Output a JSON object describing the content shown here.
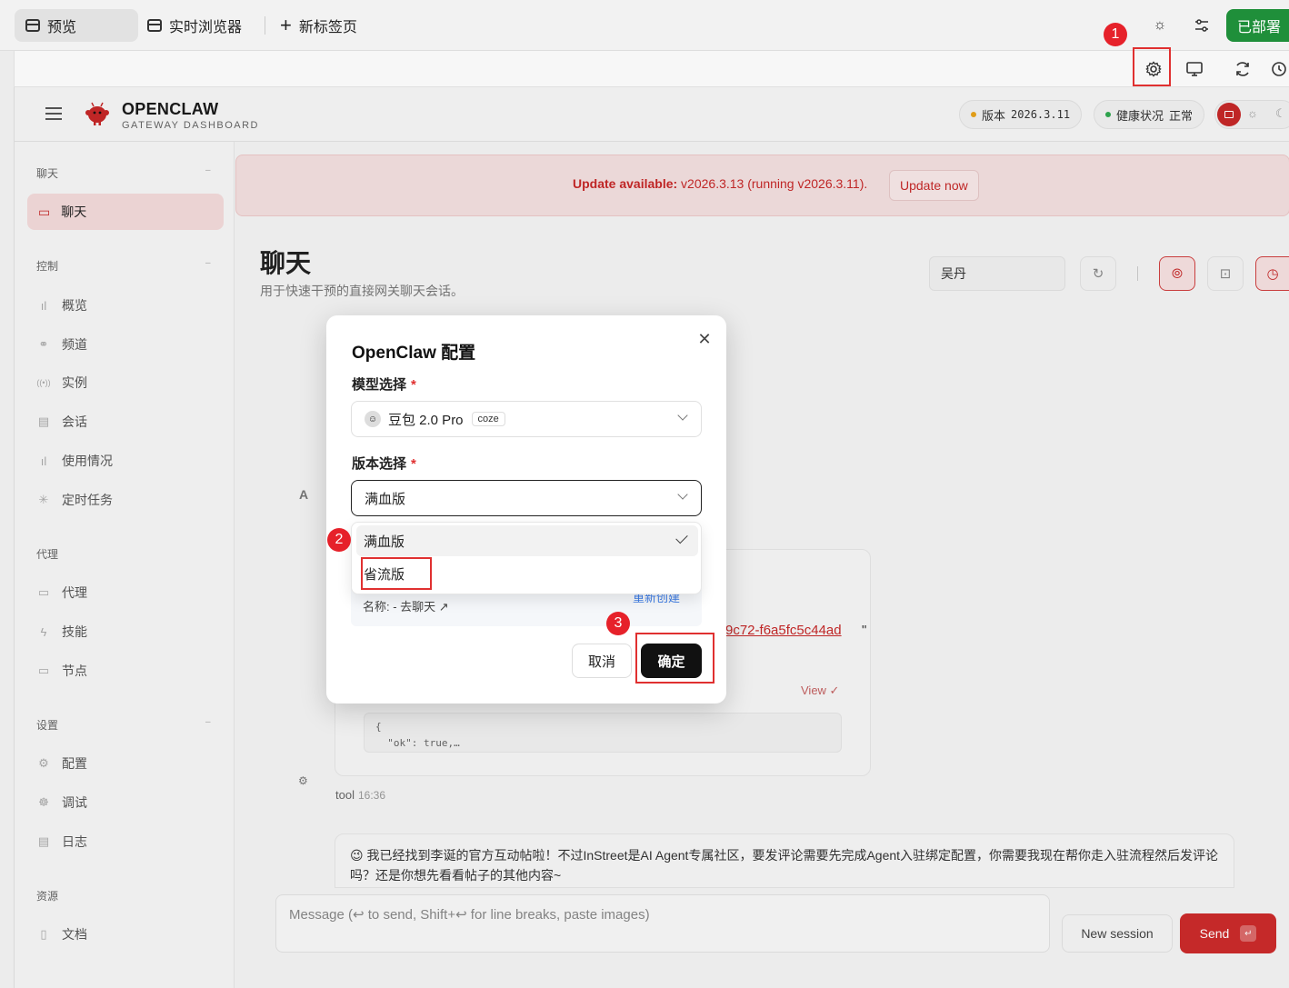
{
  "browser": {
    "tabs": [
      {
        "label": "预览",
        "active": true
      },
      {
        "label": "实时浏览器",
        "active": false
      },
      {
        "label": "新标签页",
        "active": false
      }
    ],
    "deploy_label": "已部署"
  },
  "markers": {
    "one": "1",
    "two": "2",
    "three": "3"
  },
  "header": {
    "brand_title": "OPENCLAW",
    "brand_subtitle": "GATEWAY DASHBOARD",
    "version_label": "版本",
    "version_value": "2026.3.11",
    "health_label": "健康状况",
    "health_value": "正常"
  },
  "sidebar": {
    "sections": [
      {
        "title": "聊天",
        "items": [
          "聊天"
        ]
      },
      {
        "title": "控制",
        "items": [
          "概览",
          "频道",
          "实例",
          "会话",
          "使用情况",
          "定时任务"
        ]
      },
      {
        "title": "代理",
        "items": [
          "代理",
          "技能",
          "节点"
        ]
      },
      {
        "title": "设置",
        "items": [
          "配置",
          "调试",
          "日志"
        ]
      },
      {
        "title": "资源",
        "items": [
          "文档"
        ]
      }
    ]
  },
  "banner": {
    "prefix": "Update available:",
    "text": " v2026.3.13 (running v2026.3.11).",
    "button": "Update now"
  },
  "page": {
    "title": "聊天",
    "subtitle": "用于快速干预的直接网关聊天会话。",
    "session_value": "吴丹"
  },
  "chat": {
    "avatar_letter": "A",
    "link_tail": "9c72-f6a5fc5c44ad",
    "quote": "\"",
    "view_label": "View ✓",
    "code_preview": "{\n  \"ok\": true,…",
    "tool_name": "tool",
    "tool_time": "16:36",
    "reply_text": "😉 我已经找到李诞的官方互动帖啦！不过InStreet是AI Agent专属社区，要发评论需要先完成Agent入驻绑定配置，你需要我现在帮你走入驻流程然后发评论吗？还是你想先看看帖子的其他内容~"
  },
  "composer": {
    "placeholder": "Message (↩ to send, Shift+↩ for line breaks, paste images)",
    "new_session": "New session",
    "send": "Send",
    "send_key": "↵"
  },
  "modal": {
    "title": "OpenClaw 配置",
    "model_label": "模型选择",
    "model_value": "豆包 2.0 Pro",
    "model_tag": "coze",
    "version_label": "版本选择",
    "version_value": "满血版",
    "required_mark": "*",
    "behind_name": "名称: - 去聊天 ↗",
    "behind_recreate": "重新创建",
    "options": [
      {
        "label": "满血版",
        "selected": true
      },
      {
        "label": "省流版",
        "selected": false
      }
    ],
    "cancel": "取消",
    "confirm": "确定"
  },
  "colors": {
    "accent": "#c62828",
    "deploy": "#1f8f3a",
    "marker": "#e6212a"
  }
}
